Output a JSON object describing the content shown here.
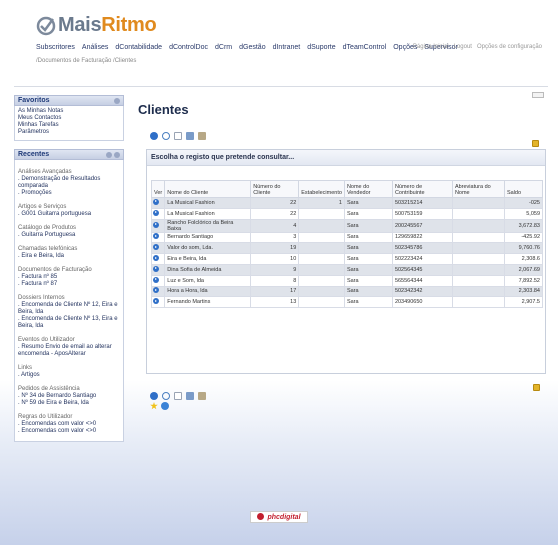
{
  "logo": {
    "text_a": "Mais",
    "text_b": "Ritmo"
  },
  "topnav": [
    "Subscritores",
    "Análises",
    "dContabilidade",
    "dControlDoc",
    "dCrm",
    "dGestão",
    "dIntranet",
    "dSuporte",
    "dTeamControl",
    "Opções",
    "Supervisor"
  ],
  "crumbs": "/Documentos de Facturação  /Clientes",
  "toplinks": [
    "Página Inicial",
    "Logout",
    "Opções de configuração"
  ],
  "favoritos": {
    "title": "Favoritos",
    "items": [
      "As Minhas Notas",
      "Meus Contactos",
      "Minhas Tarefas",
      "Parâmetros"
    ]
  },
  "recentes": {
    "title": "Recentes",
    "groups": [
      {
        "title": "Análises Avançadas",
        "links": [
          ". Demonstração de Resultados comparada",
          ". Promoções"
        ]
      },
      {
        "title": "Artigos e Serviços",
        "links": [
          ". G001 Guitarra portuguesa"
        ]
      },
      {
        "title": "Catálogo de Produtos",
        "links": [
          ". Guitarra Portuguesa"
        ]
      },
      {
        "title": "Chamadas telefónicas",
        "links": [
          ". Eira e Beira, lda"
        ]
      },
      {
        "title": "Documentos de Facturação",
        "links": [
          ". Factura nº 85",
          ". Factura nº 87"
        ]
      },
      {
        "title": "Dossiers Internos",
        "links": [
          ". Encomenda de Cliente Nº 12, Eira e Beira, lda",
          ". Encomenda de Cliente Nº 13, Eira e Beira, lda"
        ]
      },
      {
        "title": "Eventos do Utilizador",
        "links": [
          ". Resumo Envio de email ao alterar encomenda - AposAlterar"
        ]
      },
      {
        "title": "Links",
        "links": [
          ". Artigos"
        ]
      },
      {
        "title": "Pedidos de Assistência",
        "links": [
          ". Nº 34 de Bernardo Santiago",
          ". Nº 59 de Eira e Beira, lda"
        ]
      },
      {
        "title": "Regras do Utilizador",
        "links": [
          ". Encomendas com valor <>0",
          ". Encomendas com valor <>0"
        ]
      }
    ]
  },
  "main": {
    "title": "Clientes",
    "box_title": "Escolha o registo que pretende consultar...",
    "columns": [
      "Ver",
      "Nome do Cliente",
      "Número do Cliente",
      "Estabelecimento",
      "Nome do Vendedor",
      "Número de Contribuinte",
      "Abreviatura do Nome",
      "Saldo"
    ],
    "rows": [
      [
        "La Musical Fashion",
        "22",
        "1",
        "Sara",
        "503215214",
        "",
        "-025"
      ],
      [
        "La Musical Fashion",
        "22",
        "",
        "Sara",
        "500753159",
        "",
        "5,059"
      ],
      [
        "Rancho Folclórico da Beira Baixa",
        "4",
        "",
        "Sara",
        "200245567",
        "",
        "3,672.83"
      ],
      [
        "Bernardo Santiago",
        "3",
        "",
        "Sara",
        "129659822",
        "",
        "-425.92"
      ],
      [
        "Valor do som, Lda.",
        "19",
        "",
        "Sara",
        "502345786",
        "",
        "9,760.76"
      ],
      [
        "Eira e Beira, lda",
        "10",
        "",
        "Sara",
        "502223424",
        "",
        "2,308.6"
      ],
      [
        "Dina Sofia de Almeida",
        "9",
        "",
        "Sara",
        "502564345",
        "",
        "2,067.69"
      ],
      [
        "Luz e Som, lda",
        "8",
        "",
        "Sara",
        "565564344",
        "",
        "7,892.52"
      ],
      [
        "Hora a Hora, lda",
        "17",
        "",
        "Sara",
        "502342342",
        "",
        "2,303.84"
      ],
      [
        "Fernando Martins",
        "13",
        "",
        "Sara",
        "203490650",
        "",
        "2,907.5"
      ]
    ]
  },
  "footer": {
    "brand": "phcdigital"
  },
  "colors": {
    "brand_orange": "#e08a1e",
    "nav_blue": "#1f3a78",
    "row_alt": "#dfe3ea"
  }
}
